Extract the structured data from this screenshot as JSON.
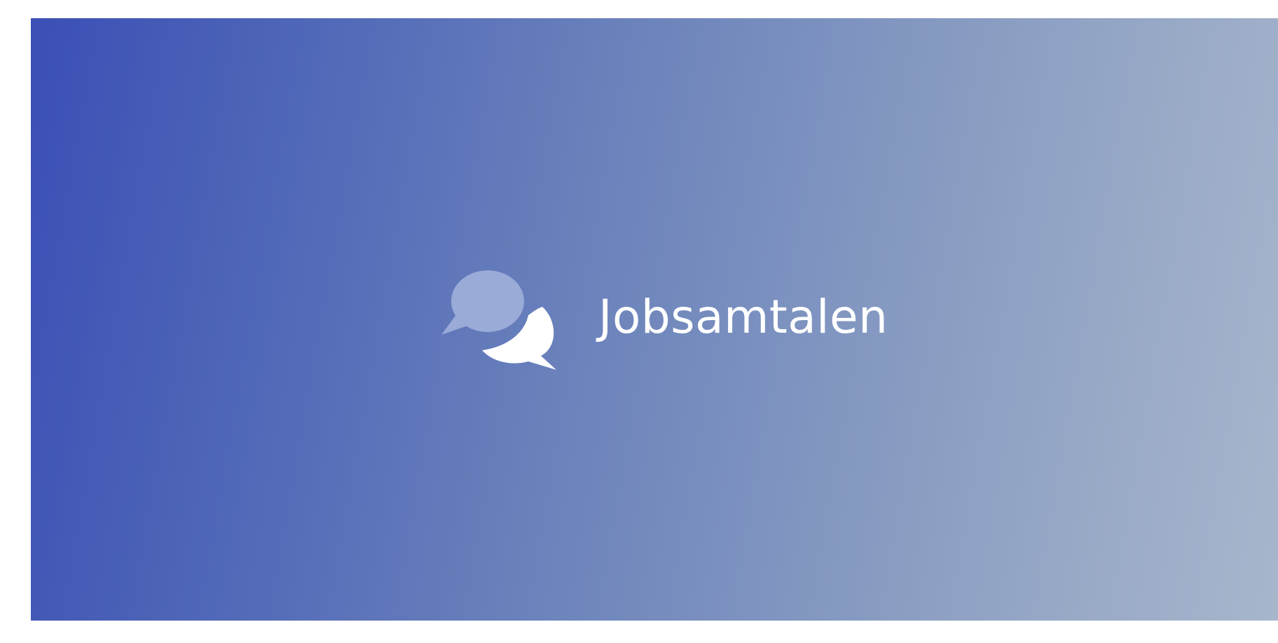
{
  "banner": {
    "logo_text": "Jobsamtalen",
    "logo_icon": "speech-bubbles-icon",
    "colors": {
      "gradient_start": "#3b4fb5",
      "gradient_end": "#a8b6cc",
      "back_bubble": "#9aabd8",
      "front_bubble": "#ffffff",
      "text": "#ffffff"
    }
  }
}
